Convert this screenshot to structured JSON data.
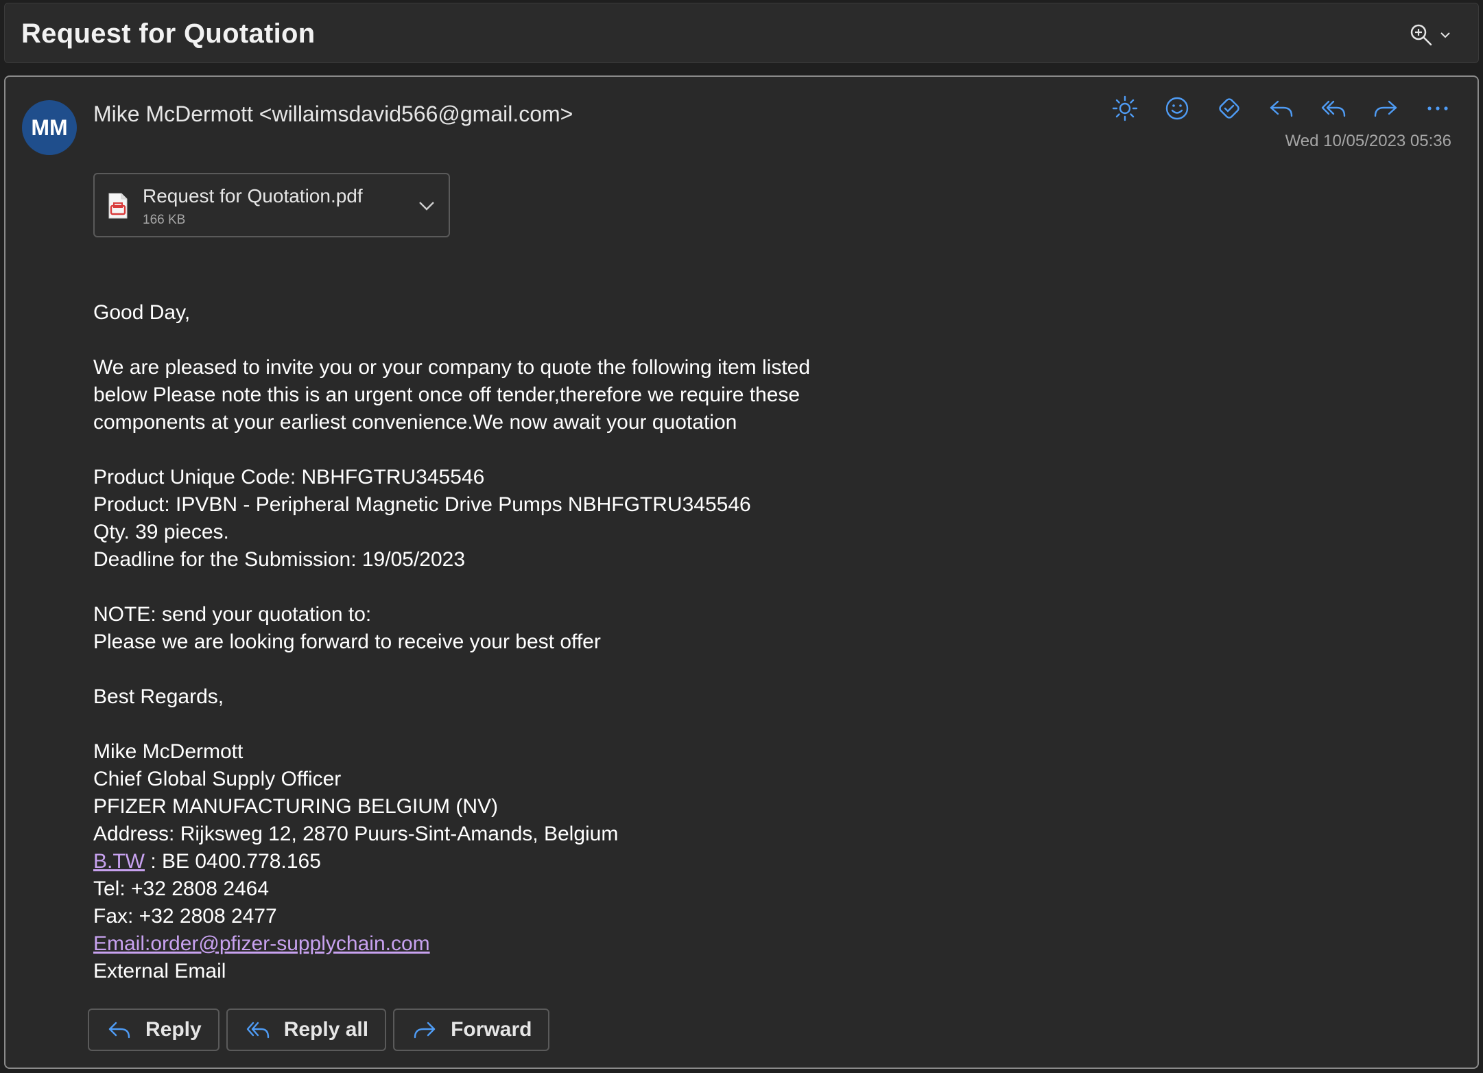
{
  "header": {
    "subject": "Request for Quotation"
  },
  "message": {
    "avatar_initials": "MM",
    "sender": "Mike McDermott <willaimsdavid566@gmail.com>",
    "date": "Wed 10/05/2023 05:36",
    "attachment": {
      "name": "Request for Quotation.pdf",
      "size": "166 KB"
    },
    "body": {
      "greeting": "Good Day,",
      "intro": [
        "We are pleased to invite you or your company to quote the following item listed",
        "below Please note this is an urgent once off tender,therefore we require these",
        "components at your earliest convenience.We now await your quotation"
      ],
      "details": [
        "Product Unique Code: NBHFGTRU345546",
        "Product: IPVBN - Peripheral Magnetic Drive Pumps NBHFGTRU345546",
        "Qty. 39 pieces.",
        "Deadline for the Submission: 19/05/2023"
      ],
      "note": [
        "NOTE: send your quotation to:",
        "Please we are looking forward to receive your best offer"
      ],
      "closing": "Best Regards,",
      "signature": {
        "name": "Mike McDermott",
        "title": "Chief Global Supply Officer",
        "company": "PFIZER MANUFACTURING BELGIUM (NV)",
        "address": "Address: Rijksweg 12, 2870 Puurs-Sint-Amands, Belgium",
        "btw_link": "B.TW",
        "btw_value": " : BE 0400.778.165",
        "tel": "Tel: +32 2808 2464",
        "fax": "Fax: +32 2808 2477",
        "email_link": "Email:order@pfizer-supplychain.com",
        "external": "External Email"
      }
    }
  },
  "buttons": {
    "reply": "Reply",
    "reply_all": "Reply all",
    "forward": "Forward"
  },
  "icons": {
    "header": [
      "zoom-icon",
      "chevron-down-icon"
    ],
    "actions": [
      "brightness-icon",
      "emoji-icon",
      "immersive-reader-icon",
      "reply-icon",
      "reply-all-icon",
      "forward-icon",
      "more-icon"
    ]
  },
  "colors": {
    "accent": "#4f9cf5",
    "avatar": "#1f4e8c",
    "link": "#c8a2f0",
    "pdf_red": "#d93b3b"
  }
}
